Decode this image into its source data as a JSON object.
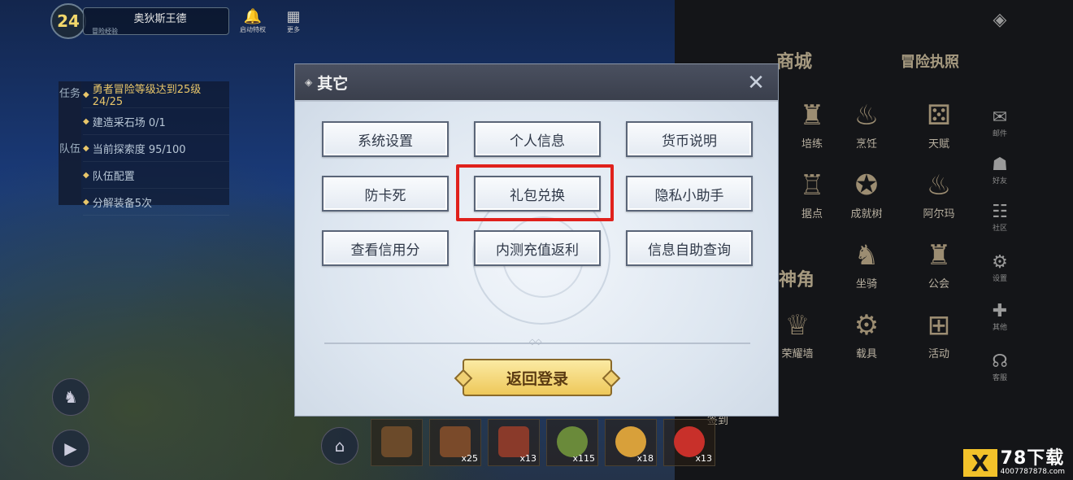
{
  "hud": {
    "level": "24",
    "player_name": "奥狄斯王德",
    "player_sub": "冒险经验",
    "icon1_label": "启动特权",
    "icon2_label": "更多"
  },
  "quests": {
    "tabs": [
      "任务",
      "队伍"
    ],
    "rows": [
      "勇者冒险等级达到25级 24/25",
      "建造采石场 0/1",
      "当前探索度 95/100",
      "队伍配置",
      "分解装备5次"
    ]
  },
  "right_menu": {
    "big": [
      "商城",
      "冒险执照",
      "神角"
    ],
    "items": [
      "培练",
      "烹饪",
      "天赋",
      "据点",
      "成就树",
      "阿尔玛",
      "坐骑",
      "公会",
      "荣耀墙",
      "载具",
      "活动",
      "签到"
    ],
    "side": [
      "邮件",
      "好友",
      "社区",
      "设置",
      "其他",
      "客服"
    ]
  },
  "hotbar": {
    "counts": [
      "",
      "x25",
      "x13",
      "x115",
      "x18",
      "x13"
    ]
  },
  "dialog": {
    "title": "其它",
    "buttons": [
      "系统设置",
      "个人信息",
      "货币说明",
      "防卡死",
      "礼包兑换",
      "隐私小助手",
      "查看信用分",
      "内测充值返利",
      "信息自助查询"
    ],
    "login_button": "返回登录"
  },
  "watermark": {
    "logo": "X",
    "title": "78下载",
    "subtitle": "4007787878.com"
  },
  "colors": {
    "highlight": "#e0211c",
    "login_button": "#eec85a"
  }
}
